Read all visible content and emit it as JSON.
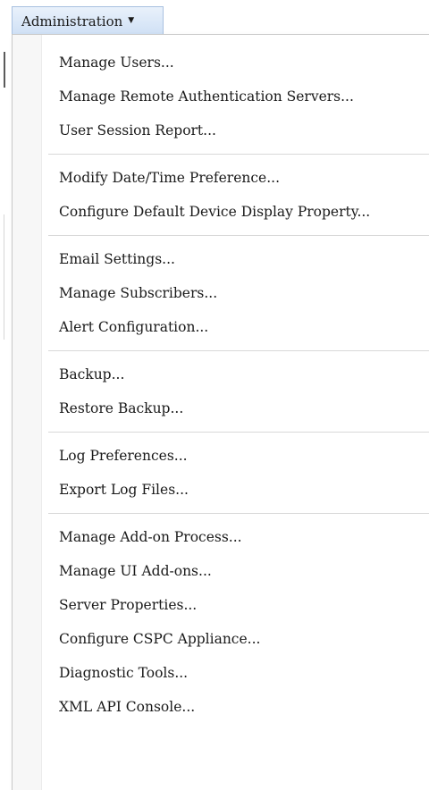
{
  "menu_button": {
    "label": "Administration",
    "caret_icon": "triangle-down-icon"
  },
  "groups": [
    {
      "items": [
        {
          "label": "Manage Users..."
        },
        {
          "label": "Manage Remote Authentication Servers..."
        },
        {
          "label": "User Session Report..."
        }
      ]
    },
    {
      "items": [
        {
          "label": "Modify Date/Time Preference..."
        },
        {
          "label": "Configure Default Device Display Property..."
        }
      ]
    },
    {
      "items": [
        {
          "label": "Email Settings..."
        },
        {
          "label": "Manage Subscribers..."
        },
        {
          "label": "Alert Configuration..."
        }
      ]
    },
    {
      "items": [
        {
          "label": "Backup..."
        },
        {
          "label": "Restore Backup..."
        }
      ]
    },
    {
      "items": [
        {
          "label": "Log Preferences..."
        },
        {
          "label": "Export Log Files..."
        }
      ]
    },
    {
      "items": [
        {
          "label": "Manage Add-on Process..."
        },
        {
          "label": "Manage UI Add-ons..."
        },
        {
          "label": "Server Properties..."
        },
        {
          "label": "Configure CSPC Appliance..."
        },
        {
          "label": "Diagnostic Tools..."
        },
        {
          "label": "XML API Console..."
        }
      ]
    }
  ]
}
